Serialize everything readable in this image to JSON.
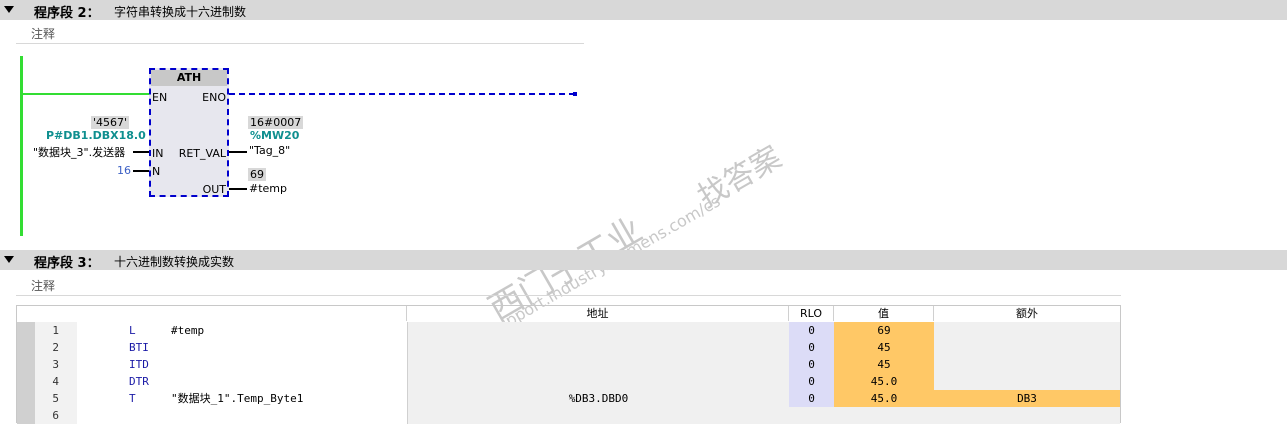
{
  "network2": {
    "title": "程序段 2：",
    "description": "字符串转换成十六进制数",
    "comment": "注释",
    "block": {
      "name": "ATH",
      "pins": {
        "en": "EN",
        "eno": "ENO",
        "in": "IN",
        "ret_val": "RET_VAL",
        "n": "N",
        "out": "OUT"
      },
      "in_value": "'4567'",
      "in_address": "P#DB1.DBX18.0",
      "in_operand": "\"数据块_3\".发送器",
      "n_value": "16",
      "ret_value": "16#0007",
      "ret_address": "%MW20",
      "ret_operand": "\"Tag_8\"",
      "out_value": "69",
      "out_operand": "#temp"
    }
  },
  "watermark": {
    "line1": "西门子工业",
    "line2": "找答案",
    "line3": "support.industry.siemens.com/cs"
  },
  "network3": {
    "title": "程序段 3：",
    "description": "十六进制数转换成实数",
    "comment": "注释",
    "table": {
      "headers": {
        "address": "地址",
        "rlo": "RLO",
        "value": "值",
        "extra": "额外"
      },
      "rows": [
        {
          "n": "1",
          "instr": "L",
          "operand": "#temp",
          "address": "",
          "rlo": "0",
          "value": "69",
          "extra": ""
        },
        {
          "n": "2",
          "instr": "BTI",
          "operand": "",
          "address": "",
          "rlo": "0",
          "value": "45",
          "extra": ""
        },
        {
          "n": "3",
          "instr": "ITD",
          "operand": "",
          "address": "",
          "rlo": "0",
          "value": "45",
          "extra": ""
        },
        {
          "n": "4",
          "instr": "DTR",
          "operand": "",
          "address": "",
          "rlo": "0",
          "value": "45.0",
          "extra": ""
        },
        {
          "n": "5",
          "instr": "T",
          "operand": "\"数据块_1\".Temp_Byte1",
          "address": "%DB3.DBD0",
          "rlo": "0",
          "value": "45.0",
          "extra": "DB3"
        },
        {
          "n": "6",
          "instr": "",
          "operand": "",
          "address": "",
          "rlo": "",
          "value": "",
          "extra": ""
        }
      ]
    }
  }
}
